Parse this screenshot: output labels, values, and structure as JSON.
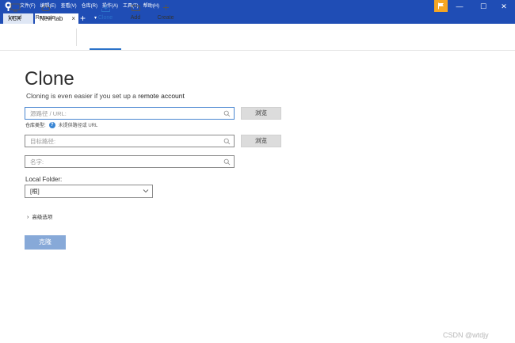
{
  "menu": [
    "文件(F)",
    "编辑(E)",
    "查看(V)",
    "仓库(R)",
    "操作(A)",
    "工具(T)",
    "帮助(H)"
  ],
  "window_controls": {
    "minimize": "—",
    "maximize": "☐",
    "close": "✕"
  },
  "tabs": [
    {
      "label": "XCX"
    },
    {
      "label": "New tab",
      "close": "×"
    }
  ],
  "tab_add": "+",
  "tab_dropdown": "▾",
  "toolbar": {
    "local": "Local",
    "remote": "Remote",
    "clone": "Clone",
    "add": "Add",
    "create": "Create"
  },
  "page": {
    "title": "Clone",
    "subtitle_prefix": "Cloning is even easier if you set up a ",
    "subtitle_link": "remote account"
  },
  "form": {
    "source_placeholder": "源路径 / URL:",
    "browse_label": "浏览",
    "repo_type_label": "仓库类型:",
    "repo_type_help": "?",
    "repo_type_hint": "未提供路径或 URL",
    "dest_placeholder": "目标路径:",
    "name_placeholder": "名字:",
    "local_folder_label": "Local Folder:",
    "local_folder_value": "[根]",
    "advanced_label": "高级选项",
    "advanced_caret": "›",
    "clone_button": "克隆"
  },
  "watermark": "CSDN @wtdjy",
  "colors": {
    "titlebar": "#1f4db5",
    "accent": "#2b72c9",
    "flag": "#f5a623",
    "clone_button": "#87a9d8"
  },
  "icons": {
    "logo": "sourcetree-logo-icon",
    "flag": "flag-icon",
    "local": "monitor-icon",
    "remote": "cloud-icon",
    "clone": "download-tray-icon",
    "add": "folder-icon",
    "create": "plus-icon",
    "search": "search-icon",
    "chevron": "chevron-down-icon"
  }
}
